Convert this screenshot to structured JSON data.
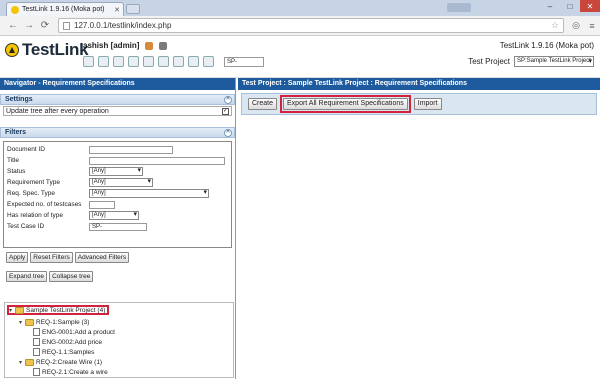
{
  "browser": {
    "tab_title": "TestLink 1.9.16 (Moka pot)",
    "url": "127.0.0.1/testlink/index.php"
  },
  "header": {
    "logo_text": "TestLink",
    "user_label": "ashish [admin]",
    "search_value": "SP-",
    "version": "TestLink 1.9.16 (Moka pot)",
    "test_project_label": "Test Project",
    "test_project_value": "SP:Sample TestLink Project"
  },
  "left": {
    "title": "Navigator - Requirement Specifications",
    "settings": {
      "heading": "Settings",
      "update_tree_label": "Update tree after every operation",
      "update_tree_checked": true
    },
    "filters": {
      "heading": "Filters",
      "rows": [
        {
          "label": "Document ID",
          "kind": "input",
          "value": ""
        },
        {
          "label": "Title",
          "kind": "input",
          "value": ""
        },
        {
          "label": "Status",
          "kind": "select",
          "value": "[Any]"
        },
        {
          "label": "Requirement Type",
          "kind": "select",
          "value": "[Any]"
        },
        {
          "label": "Req. Spec. Type",
          "kind": "select",
          "value": "[Any]"
        },
        {
          "label": "Expected no. of testcases",
          "kind": "input",
          "value": ""
        },
        {
          "label": "Has relation of type",
          "kind": "select",
          "value": "[Any]"
        },
        {
          "label": "Test Case ID",
          "kind": "input",
          "value": "SP-"
        }
      ]
    },
    "buttons": {
      "apply": "Apply",
      "reset": "Reset Filters",
      "advanced": "Advanced Filters",
      "expand": "Expand tree",
      "collapse": "Collapse tree"
    },
    "tree": [
      {
        "label": "Sample TestLink Project (4)",
        "type": "folder",
        "level": 0
      },
      {
        "label": "REQ-1:Sample (3)",
        "type": "folder",
        "level": 1
      },
      {
        "label": "ENG-0001:Add a product",
        "type": "doc",
        "level": 2
      },
      {
        "label": "ENG-0002:Add price",
        "type": "doc",
        "level": 2
      },
      {
        "label": "REQ-1.1:Samples",
        "type": "doc",
        "level": 2
      },
      {
        "label": "REQ-2:Create Wire (1)",
        "type": "folder",
        "level": 1
      },
      {
        "label": "REQ-2.1:Create a wire",
        "type": "doc",
        "level": 2
      }
    ]
  },
  "right": {
    "title": "Test Project : Sample TestLink Project : Requirement Specifications",
    "buttons": {
      "create": "Create",
      "export_all": "Export All Requirement Specifications",
      "import": "Import"
    }
  },
  "colors": {
    "nav_title_bg": "#1d5b9e",
    "highlight": "#d2223c"
  }
}
